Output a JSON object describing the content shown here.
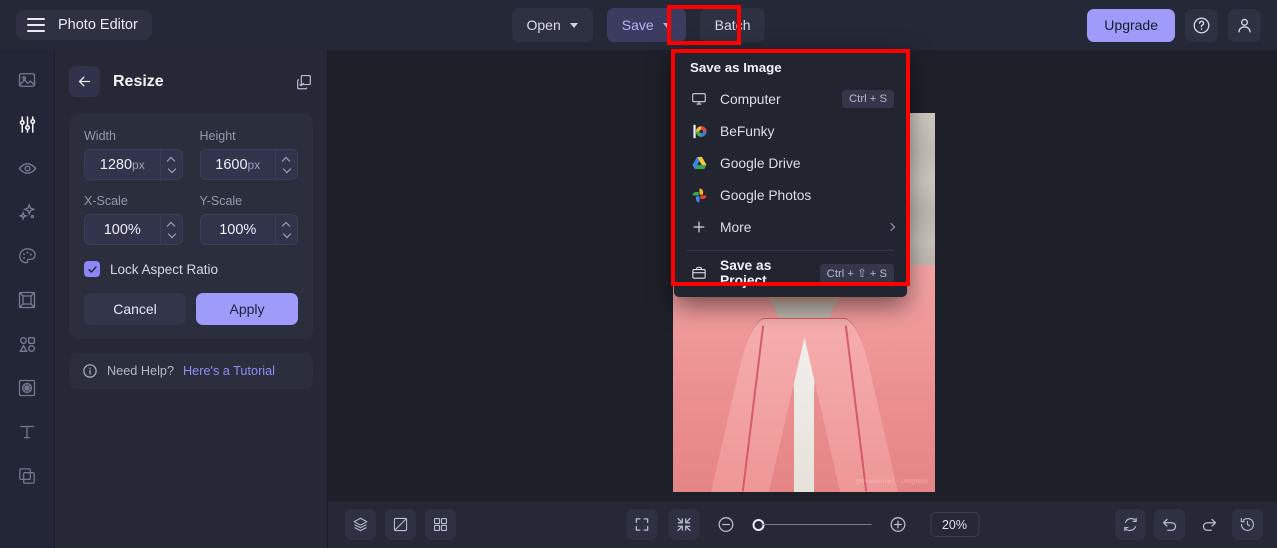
{
  "header": {
    "brand": "Photo Editor",
    "menu_icon": "hamburger-icon",
    "buttons": [
      {
        "label": "Open",
        "has_caret": true,
        "active": false
      },
      {
        "label": "Save",
        "has_caret": true,
        "active": true
      },
      {
        "label": "Batch",
        "has_caret": false,
        "active": false
      }
    ],
    "upgrade_label": "Upgrade",
    "help_icon": "question-circle-icon",
    "account_icon": "user-icon"
  },
  "rail": {
    "items": [
      {
        "name": "image-icon",
        "selected": false
      },
      {
        "name": "adjust-sliders-icon",
        "selected": true
      },
      {
        "name": "eye-retouch-icon",
        "selected": false
      },
      {
        "name": "sparkle-effects-icon",
        "selected": false
      },
      {
        "name": "palette-artsy-icon",
        "selected": false
      },
      {
        "name": "frame-icon",
        "selected": false
      },
      {
        "name": "shapes-graphics-icon",
        "selected": false
      },
      {
        "name": "texture-icon",
        "selected": false
      },
      {
        "name": "text-icon",
        "selected": false
      },
      {
        "name": "overlay-layers-icon",
        "selected": false
      }
    ]
  },
  "panel": {
    "title": "Resize",
    "back_icon": "back-arrow-icon",
    "duplicate_icon": "duplicate-icon",
    "fields": [
      {
        "label": "Width",
        "value": "1280",
        "unit": "px"
      },
      {
        "label": "Height",
        "value": "1600",
        "unit": "px"
      },
      {
        "label": "X-Scale",
        "value": "100%",
        "unit": ""
      },
      {
        "label": "Y-Scale",
        "value": "100%",
        "unit": ""
      }
    ],
    "lock_label": "Lock Aspect Ratio",
    "lock_checked": true,
    "cancel_label": "Cancel",
    "apply_label": "Apply",
    "help_text": "Need Help?",
    "help_link": "Here's a Tutorial",
    "help_icon": "info-icon"
  },
  "dropdown": {
    "heading": "Save as Image",
    "items": [
      {
        "label": "Computer",
        "icon": "monitor-icon",
        "shortcut": "Ctrl + S",
        "bold": false,
        "submenu": false
      },
      {
        "label": "BeFunky",
        "icon": "befunky-logo-icon",
        "shortcut": "",
        "bold": false,
        "submenu": false
      },
      {
        "label": "Google Drive",
        "icon": "google-drive-icon",
        "shortcut": "",
        "bold": false,
        "submenu": false
      },
      {
        "label": "Google Photos",
        "icon": "google-photos-icon",
        "shortcut": "",
        "bold": false,
        "submenu": false
      },
      {
        "label": "More",
        "icon": "plus-icon",
        "shortcut": "",
        "bold": false,
        "submenu": true
      }
    ],
    "project": {
      "label": "Save as Project",
      "icon": "briefcase-icon",
      "shortcut": "Ctrl + ⇧ + S",
      "bold": true
    }
  },
  "canvas": {
    "photo_alt": "person-in-pink-blazer-photo",
    "credit": "@chadsonart - Unsplash"
  },
  "bottombar": {
    "left_buttons": [
      {
        "name": "layers-icon"
      },
      {
        "name": "compare-icon"
      },
      {
        "name": "grid-icon"
      }
    ],
    "center_buttons": [
      {
        "name": "fit-screen-icon"
      },
      {
        "name": "shrink-icon"
      }
    ],
    "zoom_out_icon": "zoom-out-icon",
    "zoom_in_icon": "zoom-in-icon",
    "zoom_value": "20%",
    "right_buttons": [
      {
        "name": "reset-icon"
      },
      {
        "name": "undo-icon"
      },
      {
        "name": "redo-icon"
      },
      {
        "name": "history-icon"
      }
    ]
  },
  "colors": {
    "accent": "#9e9bfa",
    "annotation": "#fe0000",
    "panel_bg": "#262935",
    "header_bg": "#252836",
    "canvas_bg": "#1e2029",
    "menu_bg": "#22242f"
  }
}
